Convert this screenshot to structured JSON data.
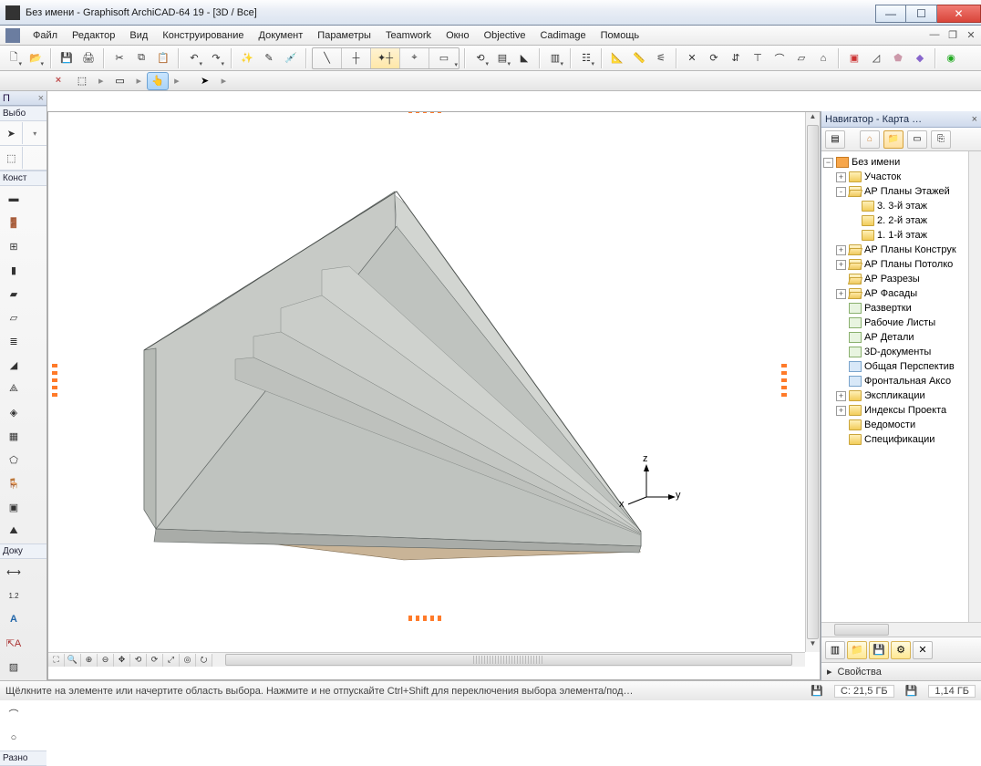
{
  "window": {
    "title": "Без имени - Graphisoft ArchiCAD-64 19 - [3D / Все]"
  },
  "menu": [
    "Файл",
    "Редактор",
    "Вид",
    "Конструирование",
    "Документ",
    "Параметры",
    "Teamwork",
    "Окно",
    "Objective",
    "Cadimage",
    "Помощь"
  ],
  "toolbox": {
    "header": "П",
    "section1": "Выбо",
    "section2": "Конст",
    "section3": "Доку",
    "section4": "Разно"
  },
  "navigator": {
    "title": "Навигатор - Карта …",
    "root": "Без имени",
    "items": [
      {
        "l": "Участок",
        "d": 1,
        "e": "+",
        "ic": "folder"
      },
      {
        "l": "АР Планы Этажей",
        "d": 1,
        "e": "-",
        "ic": "folderopen"
      },
      {
        "l": "3. 3-й этаж",
        "d": 2,
        "e": "",
        "ic": "folder"
      },
      {
        "l": "2. 2-й этаж",
        "d": 2,
        "e": "",
        "ic": "folder"
      },
      {
        "l": "1. 1-й этаж",
        "d": 2,
        "e": "",
        "ic": "folder"
      },
      {
        "l": "АР Планы Конструк",
        "d": 1,
        "e": "+",
        "ic": "folderopen"
      },
      {
        "l": "АР Планы Потолко",
        "d": 1,
        "e": "+",
        "ic": "folderopen"
      },
      {
        "l": "АР Разрезы",
        "d": 1,
        "e": "",
        "ic": "folderopen"
      },
      {
        "l": "АР Фасады",
        "d": 1,
        "e": "+",
        "ic": "folderopen"
      },
      {
        "l": "Развертки",
        "d": 1,
        "e": "",
        "ic": "doc"
      },
      {
        "l": "Рабочие Листы",
        "d": 1,
        "e": "",
        "ic": "doc"
      },
      {
        "l": "АР Детали",
        "d": 1,
        "e": "",
        "ic": "doc"
      },
      {
        "l": "3D-документы",
        "d": 1,
        "e": "",
        "ic": "doc"
      },
      {
        "l": "Общая Перспектив",
        "d": 1,
        "e": "",
        "ic": "persp"
      },
      {
        "l": "Фронтальная Аксо",
        "d": 1,
        "e": "",
        "ic": "persp"
      },
      {
        "l": "Экспликации",
        "d": 1,
        "e": "+",
        "ic": "folder"
      },
      {
        "l": "Индексы Проекта",
        "d": 1,
        "e": "+",
        "ic": "folder"
      },
      {
        "l": "Ведомости",
        "d": 1,
        "e": "",
        "ic": "folder"
      },
      {
        "l": "Спецификации",
        "d": 1,
        "e": "",
        "ic": "folder"
      }
    ],
    "props": "Свойства"
  },
  "axis": {
    "x": "x",
    "y": "y",
    "z": "z"
  },
  "status": {
    "hint": "Щёлкните на элементе или начертите область выбора. Нажмите и не отпускайте Ctrl+Shift для переключения выбора элемента/под…",
    "c": "C: 21,5 ГБ",
    "d": "1,14 ГБ"
  }
}
